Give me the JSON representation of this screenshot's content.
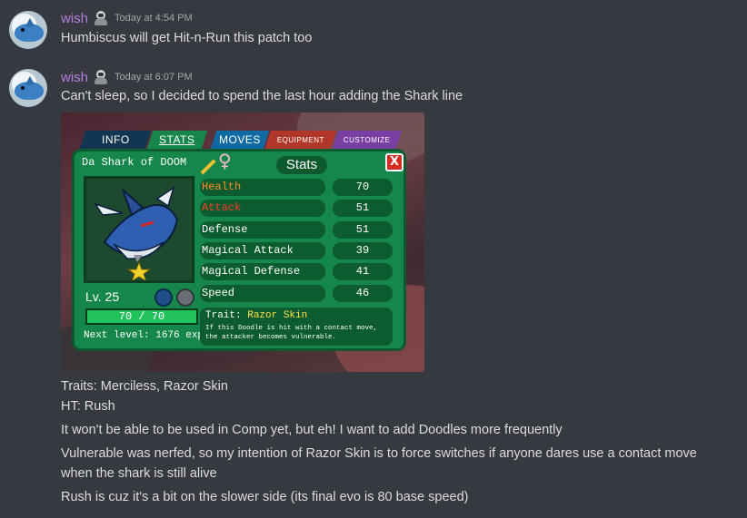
{
  "messages": [
    {
      "username": "wish",
      "timestamp": "Today at 4:54 PM",
      "text": "Humbiscus will get Hit-n-Run this patch too"
    },
    {
      "username": "wish",
      "timestamp": "Today at 6:07 PM",
      "lines": [
        "Can't sleep, so I decided to spend the last hour adding the Shark line",
        "Traits: Merciless, Razor Skin",
        "HT: Rush",
        "It won't be able to be used in Comp yet, but eh! I want to add Doodles more frequently",
        "Vulnerable was nerfed, so my intention of Razor Skin is to force switches if anyone dares use a contact move",
        "when the shark is still alive",
        "Rush is cuz it's a bit on the slower side (its final evo is 80 base speed)"
      ]
    }
  ],
  "game": {
    "tabs": [
      "INFO",
      "STATS",
      "MOVES",
      "EQUIPMENT",
      "CUSTOMIZE"
    ],
    "doodle_name": "Da Shark of DOOM",
    "gender_symbol": "♀",
    "panel_title": "Stats",
    "close": "X",
    "level": "Lv. 25",
    "hp_text": "70 / 70",
    "hp_fraction": 1.0,
    "next_level": "Next level: 1676 exp",
    "stats": [
      {
        "label": "Health",
        "value": "70"
      },
      {
        "label": "Attack",
        "value": "51"
      },
      {
        "label": "Defense",
        "value": "51"
      },
      {
        "label": "Magical Attack",
        "value": "39"
      },
      {
        "label": "Magical Defense",
        "value": "41"
      },
      {
        "label": "Speed",
        "value": "46"
      }
    ],
    "trait_label": "Trait:",
    "trait_name": "Razor Skin",
    "trait_desc_1": "If this Doodle is hit with a contact move,",
    "trait_desc_2": "the attacker becomes vulnerable."
  },
  "colors": {
    "background": "#36393f",
    "username": "#b57edc",
    "text": "#dcddde"
  }
}
